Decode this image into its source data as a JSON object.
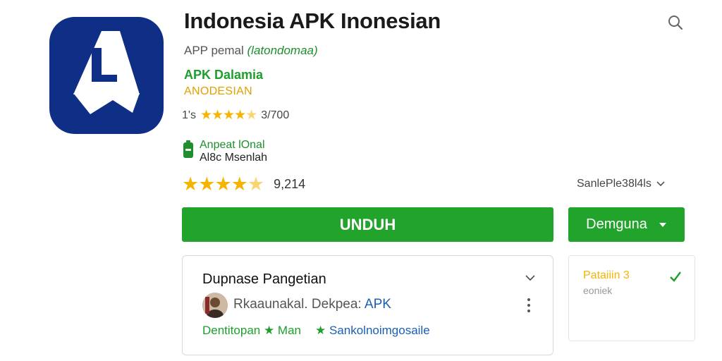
{
  "app": {
    "title": "Indonesia APK Inonesian",
    "subtitle_prefix": "APP",
    "subtitle_name": "pemal",
    "subtitle_paren": "(latondomaa)",
    "developer": "APK Dalamia",
    "category": "ANODESIAN",
    "small_rating_prefix": "1's",
    "small_rating_count": "3/700",
    "small_stars": 4.5
  },
  "badge": {
    "line1": "Anpeat lOnal",
    "line2": "Al8c Msenlah",
    "icon": "phone-battery-icon"
  },
  "rating": {
    "stars": 4.5,
    "count": "9,214",
    "filter_label": "SanlePle38l4ls"
  },
  "actions": {
    "download_label": "UNDUH",
    "dropdown_label": "Demguna"
  },
  "card": {
    "title": "Dupnase Pangetian",
    "author_name": "Rkaaunakal. Dekpea:",
    "author_link": "APK",
    "tag1": "Dentitopan ★ Man",
    "tag2_star": "★",
    "tag2": "Sankolnoimgosaile"
  },
  "side_card": {
    "title": "Pataiiin 3",
    "subtitle": "eoniek"
  },
  "colors": {
    "green": "#22a32b",
    "icon_bg": "#0f2f86",
    "star": "#f4b400",
    "link_blue": "#1a5fb4"
  }
}
